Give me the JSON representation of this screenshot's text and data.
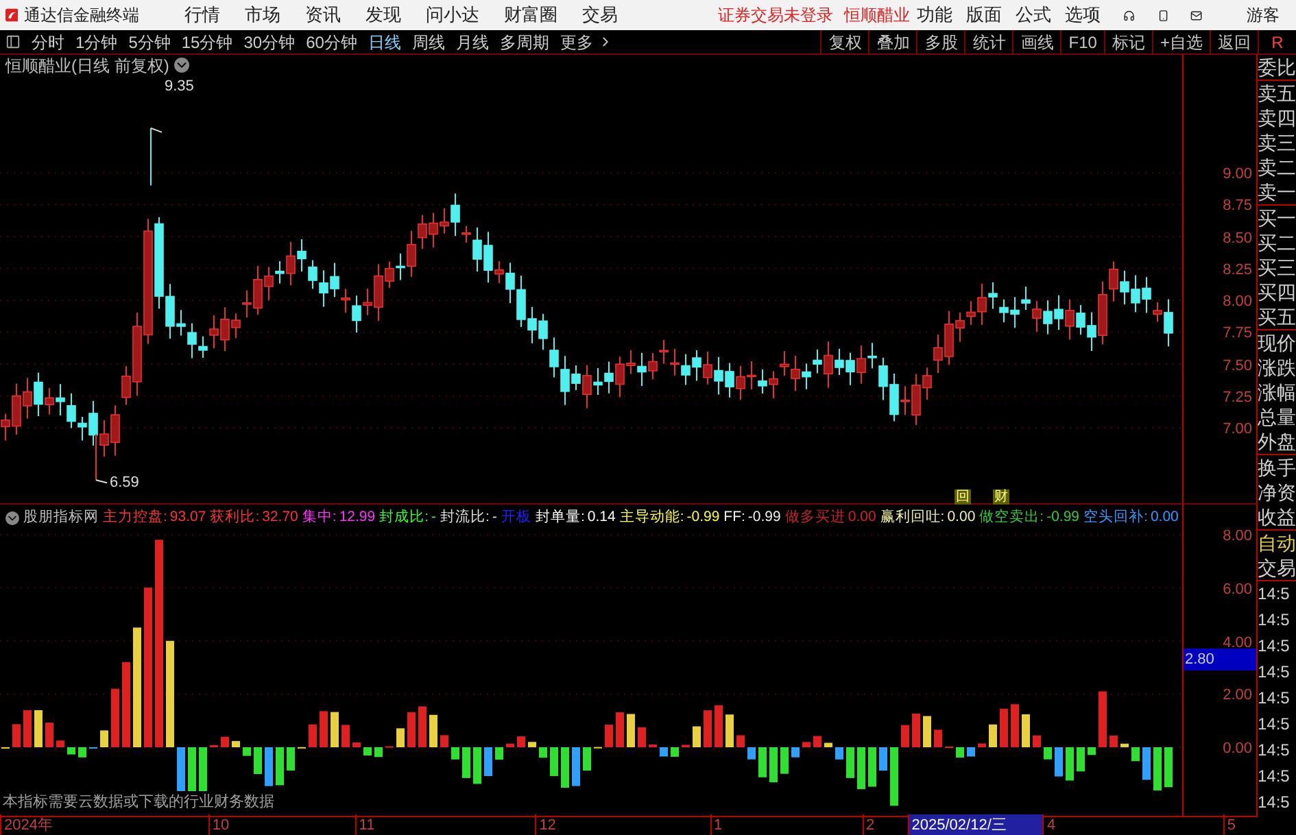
{
  "title_bar": {
    "app_name": "通达信金融终端",
    "menu": [
      "行情",
      "市场",
      "资讯",
      "发现",
      "问小达",
      "财富圈",
      "交易"
    ],
    "status": "证券交易未登录",
    "stock": "恒顺醋业",
    "tools": [
      "功能",
      "版面",
      "公式",
      "选项"
    ],
    "user": "游客"
  },
  "period_bar": {
    "periods": [
      {
        "label": "分时",
        "selected": false
      },
      {
        "label": "1分钟",
        "selected": false
      },
      {
        "label": "5分钟",
        "selected": false
      },
      {
        "label": "15分钟",
        "selected": false
      },
      {
        "label": "30分钟",
        "selected": false
      },
      {
        "label": "60分钟",
        "selected": false
      },
      {
        "label": "日线",
        "selected": true
      },
      {
        "label": "周线",
        "selected": false
      },
      {
        "label": "月线",
        "selected": false
      },
      {
        "label": "多周期",
        "selected": false
      }
    ],
    "more": "更多",
    "actions": [
      "复权",
      "叠加",
      "多股",
      "统计",
      "画线",
      "F10",
      "标记",
      "+自选",
      "返回"
    ],
    "corner": "R"
  },
  "main_chart": {
    "title": "恒顺醋业(日线 前复权)",
    "high_label": "9.35",
    "low_label": "6.59",
    "markers": [
      "回",
      "财"
    ],
    "y_ticks": [
      "9.00",
      "8.75",
      "8.50",
      "8.25",
      "8.00",
      "7.75",
      "7.50",
      "7.25",
      "7.00"
    ]
  },
  "indicator": {
    "name": "股朋指标网",
    "items": [
      {
        "label": "主力控盘:",
        "value": "93.07",
        "color": "#ff3333"
      },
      {
        "label": "获利比:",
        "value": "32.70",
        "color": "#ff3333"
      },
      {
        "label": "集中:",
        "value": "12.99",
        "color": "#ff33ff"
      },
      {
        "label": "封成比:",
        "value": "-",
        "color": "#33ff33"
      },
      {
        "label": "封流比:",
        "value": "-",
        "color": "#e0e0e0"
      },
      {
        "label": "开板",
        "color": "#2222ff"
      },
      {
        "label": "封单量:",
        "value": "0.14",
        "color": "#ffffff"
      },
      {
        "label": "主导动能:",
        "value": "-0.99",
        "color": "#ffff33"
      },
      {
        "label": "FF:",
        "value": "-0.99",
        "color": "#f0f0f0"
      },
      {
        "label": "做多买进",
        "value": "0.00",
        "color": "#cc2222"
      },
      {
        "label": "赢利回吐:",
        "value": "0.00",
        "color": "#f0f0a0"
      },
      {
        "label": "做空卖出:",
        "value": "-0.99",
        "color": "#33cc33"
      },
      {
        "label": "空头回补:",
        "value": "0.00",
        "color": "#3399ff"
      }
    ],
    "y_ticks": [
      "8.00",
      "6.00",
      "4.00",
      "2.00",
      "0.00"
    ],
    "current": "2.80",
    "note": "本指标需要云数据或下载的行业财务数据"
  },
  "date_axis": [
    {
      "label": "2024年",
      "selected": false
    },
    {
      "label": "10",
      "selected": false
    },
    {
      "label": "11",
      "selected": false
    },
    {
      "label": "12",
      "selected": false
    },
    {
      "label": "1",
      "selected": false
    },
    {
      "label": "2",
      "selected": false
    },
    {
      "label": "2025/02/12/三",
      "selected": true
    },
    {
      "label": "4",
      "selected": false
    },
    {
      "label": "5",
      "selected": false
    }
  ],
  "side_panel": {
    "groups": [
      [
        "委比"
      ],
      [
        "卖五",
        "卖四",
        "卖三",
        "卖二",
        "卖一"
      ],
      [
        "买一",
        "买二",
        "买三",
        "买四",
        "买五"
      ],
      [
        "现价",
        "涨跌",
        "涨幅",
        "总量",
        "外盘"
      ],
      [
        "换手",
        "净资",
        "收益"
      ]
    ],
    "mode": "自动",
    "trade": "交易",
    "times": [
      "14:5",
      "14:5",
      "14:5",
      "14:5",
      "14:5",
      "14:5",
      "14:5",
      "14:5",
      "14:5"
    ]
  }
}
